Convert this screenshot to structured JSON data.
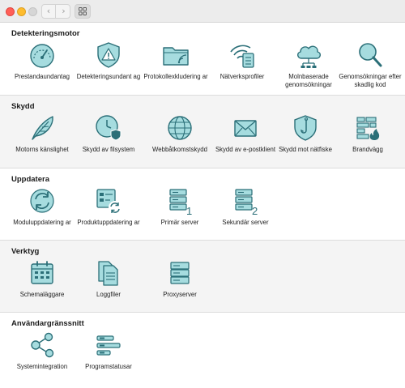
{
  "window": {
    "nav_back": "‹",
    "nav_forward": "›"
  },
  "colors": {
    "icon_fill": "#a6dcdf",
    "icon_stroke": "#2b6f78",
    "alt_section_bg": "#f4f4f4"
  },
  "sections": [
    {
      "title": "Detekteringsmotor",
      "items": [
        {
          "label": "Prestandaundantag",
          "icon": "gauge-icon"
        },
        {
          "label": "Detekteringsundant ag",
          "icon": "warning-shield-icon"
        },
        {
          "label": "Protokollexkludering ar",
          "icon": "folder-signal-icon"
        },
        {
          "label": "Nätverksprofiler",
          "icon": "wifi-list-icon"
        },
        {
          "label": "Molnbaserade genomsökningar",
          "icon": "cloud-network-icon"
        },
        {
          "label": "Genomsökningar efter skadlig kod",
          "icon": "magnifier-icon"
        }
      ]
    },
    {
      "title": "Skydd",
      "items": [
        {
          "label": "Motorns känslighet",
          "icon": "feather-icon"
        },
        {
          "label": "Skydd av filsystem",
          "icon": "clock-shield-icon"
        },
        {
          "label": "Webbåtkomstskydd",
          "icon": "globe-icon"
        },
        {
          "label": "Skydd av e-postklient",
          "icon": "envelope-icon"
        },
        {
          "label": "Skydd mot nätfiske",
          "icon": "fishhook-shield-icon"
        },
        {
          "label": "Brandvägg",
          "icon": "firewall-icon"
        }
      ]
    },
    {
      "title": "Uppdatera",
      "items": [
        {
          "label": "Moduluppdatering ar",
          "icon": "refresh-icon"
        },
        {
          "label": "Produktuppdatering ar",
          "icon": "app-refresh-icon"
        },
        {
          "label": "Primär server",
          "icon": "server-1-icon",
          "badge": "1"
        },
        {
          "label": "Sekundär server",
          "icon": "server-2-icon",
          "badge": "2"
        }
      ]
    },
    {
      "title": "Verktyg",
      "items": [
        {
          "label": "Schemaläggare",
          "icon": "calendar-icon"
        },
        {
          "label": "Loggfiler",
          "icon": "documents-icon"
        },
        {
          "label": "Proxyserver",
          "icon": "proxy-server-icon"
        }
      ]
    },
    {
      "title": "Användargränssnitt",
      "items": [
        {
          "label": "Systemintegration",
          "icon": "share-nodes-icon"
        },
        {
          "label": "Programstatusar",
          "icon": "status-bars-icon"
        }
      ]
    }
  ]
}
